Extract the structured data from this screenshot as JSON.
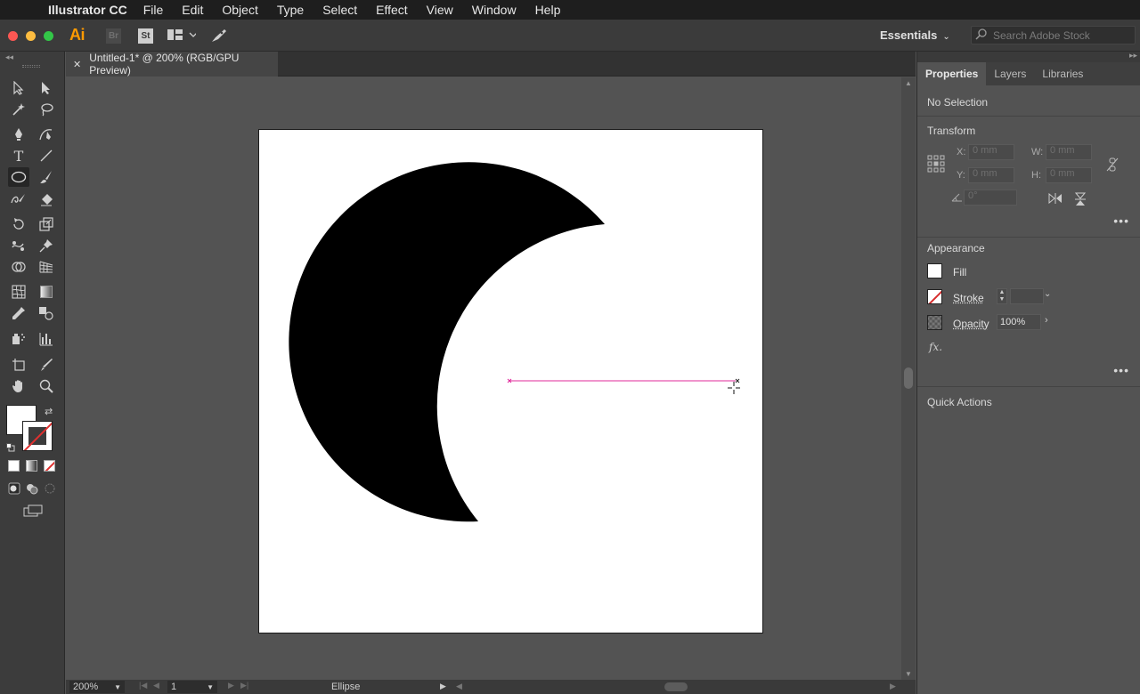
{
  "menubar": {
    "app_name": "Illustrator CC",
    "items": [
      "File",
      "Edit",
      "Object",
      "Type",
      "Select",
      "Effect",
      "View",
      "Window",
      "Help"
    ]
  },
  "appbar": {
    "logo": "Ai",
    "bridge_label": "Br",
    "stock_label": "St",
    "workspace": "Essentials",
    "search_placeholder": "Search Adobe Stock"
  },
  "document": {
    "tab_title": "Untitled-1* @ 200% (RGB/GPU Preview)"
  },
  "status": {
    "zoom": "200%",
    "artboard_number": "1",
    "current_tool": "Ellipse"
  },
  "panel": {
    "tabs": [
      "Properties",
      "Layers",
      "Libraries"
    ],
    "active_tab": "Properties",
    "selection": "No Selection",
    "transform": {
      "label": "Transform",
      "x_label": "X:",
      "y_label": "Y:",
      "w_label": "W:",
      "h_label": "H:",
      "x_value": "0 mm",
      "y_value": "0 mm",
      "w_value": "0 mm",
      "h_value": "0 mm",
      "angle_value": "0°"
    },
    "appearance": {
      "label": "Appearance",
      "fill_label": "Fill",
      "stroke_label": "Stroke",
      "opacity_label": "Opacity",
      "opacity_value": "100%",
      "fx_label": "fx."
    },
    "quick_actions": {
      "label": "Quick Actions"
    }
  },
  "colors": {
    "fill": "#ffffff",
    "stroke": "none",
    "smart_guide": "#e0289a",
    "artwork": "#000000",
    "accent_logo": "#ff9a00"
  }
}
